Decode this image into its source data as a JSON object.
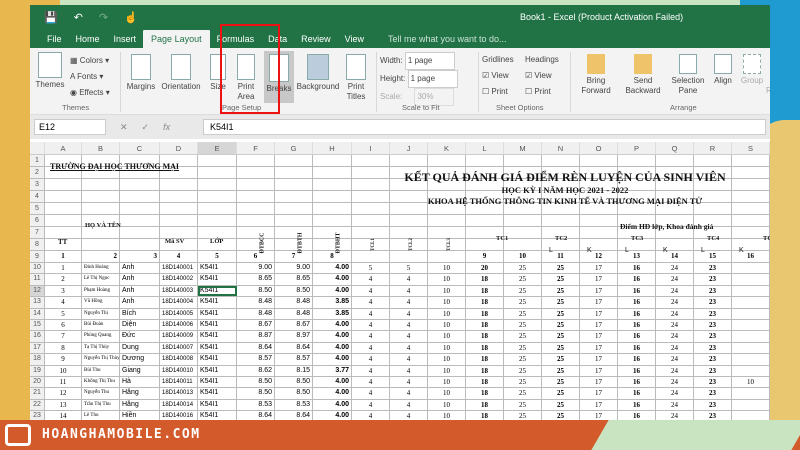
{
  "window": {
    "title": "Book1 - Excel (Product Activation Failed)"
  },
  "tabs": [
    "File",
    "Home",
    "Insert",
    "Page Layout",
    "Formulas",
    "Data",
    "Review",
    "View"
  ],
  "active_tab": "Page Layout",
  "tell_me": "Tell me what you want to do...",
  "ribbon": {
    "themes": {
      "themes": "Themes",
      "colors": "Colors",
      "fonts": "Fonts",
      "effects": "Effects",
      "group": "Themes"
    },
    "page_setup": {
      "margins": "Margins",
      "orientation": "Orientation",
      "size": "Size",
      "print_area": "Print Area",
      "breaks": "Breaks",
      "background": "Background",
      "print_titles": "Print Titles",
      "group": "Page Setup"
    },
    "scale": {
      "width_label": "Width:",
      "width": "1 page",
      "height_label": "Height:",
      "height": "1 page",
      "scale_label": "Scale:",
      "scale": "30%",
      "group": "Scale to Fit"
    },
    "sheet_options": {
      "gridlines": "Gridlines",
      "headings": "Headings",
      "view": "View",
      "print": "Print",
      "gridlines_view": true,
      "gridlines_print": false,
      "headings_view": true,
      "headings_print": false,
      "group": "Sheet Options"
    },
    "arrange": {
      "bring_forward": "Bring Forward",
      "send_backward": "Send Backward",
      "selection_pane": "Selection Pane",
      "align": "Align",
      "group_btn": "Group",
      "rotate": "Ro",
      "group": "Arrange"
    }
  },
  "formula_bar": {
    "name_box": "E12",
    "value": "K54I1"
  },
  "columns": [
    "A",
    "B",
    "C",
    "D",
    "E",
    "F",
    "G",
    "H",
    "I",
    "J",
    "K",
    "L",
    "M",
    "N",
    "O",
    "P",
    "Q",
    "R",
    "S"
  ],
  "sheet": {
    "school": "TRƯỜNG ĐẠI HỌC THƯƠNG MẠI",
    "title1": "KẾT QUẢ ĐÁNH GIÁ ĐIỂM RÈN LUYỆN CỦA SINH VIÊN",
    "title2": "HỌC KỲ I NĂM HỌC 2021 - 2022",
    "title3": "KHOA HỆ THỐNG THÔNG TIN KINH TẾ VÀ THƯƠNG MẠI ĐIỆN TỬ",
    "h_tt": "TT",
    "h_name": "HỌ VÀ TÊN",
    "h_masv": "Mã SV",
    "h_lop": "LỚP",
    "h_dtbcc": "ĐTBCC",
    "h_dtbth": "ĐTBTH",
    "h_dtbht": "ĐTBHT",
    "h_tcl1": "TCL1",
    "h_tcl2": "TCL2",
    "h_tcl3": "TCL3",
    "h_diem": "Điểm HĐ lớp, Khoa đánh giá",
    "tc": [
      "TC1",
      "TC2",
      "TC3",
      "TC4",
      "TC"
    ],
    "lk": [
      "L",
      "K",
      "L",
      "K",
      "L",
      "K",
      "L"
    ],
    "row9": [
      "1",
      "2",
      "3",
      "4",
      "5",
      "6",
      "7",
      "8",
      "",
      "",
      "",
      "9",
      "10",
      "11",
      "12",
      "13",
      "14",
      "15",
      "16"
    ],
    "rows": [
      [
        "1",
        "Đinh Hoàng",
        "Anh",
        "18D140001",
        "K54I1",
        "9.00",
        "9.00",
        "4.00",
        "5",
        "5",
        "10",
        "20",
        "25",
        "25",
        "17",
        "16",
        "24",
        "23",
        ""
      ],
      [
        "2",
        "Lê Thị Ngọc",
        "Anh",
        "18D140002",
        "K54I1",
        "8.65",
        "8.65",
        "4.00",
        "4",
        "4",
        "10",
        "18",
        "25",
        "25",
        "17",
        "16",
        "24",
        "23",
        ""
      ],
      [
        "3",
        "Phạm Hoàng",
        "Anh",
        "18D140003",
        "K54I1",
        "8.50",
        "8.50",
        "4.00",
        "4",
        "4",
        "10",
        "18",
        "25",
        "25",
        "17",
        "16",
        "24",
        "23",
        ""
      ],
      [
        "4",
        "Vũ Hồng",
        "Anh",
        "18D140004",
        "K54I1",
        "8.48",
        "8.48",
        "3.85",
        "4",
        "4",
        "10",
        "18",
        "25",
        "25",
        "17",
        "16",
        "24",
        "23",
        ""
      ],
      [
        "5",
        "Nguyễn Thị",
        "Bích",
        "18D140005",
        "K54I1",
        "8.48",
        "8.48",
        "3.85",
        "4",
        "4",
        "10",
        "18",
        "25",
        "25",
        "17",
        "16",
        "24",
        "23",
        ""
      ],
      [
        "6",
        "Bùi Đoàn",
        "Diện",
        "18D140006",
        "K54I1",
        "8.67",
        "8.67",
        "4.00",
        "4",
        "4",
        "10",
        "18",
        "25",
        "25",
        "17",
        "16",
        "24",
        "23",
        ""
      ],
      [
        "7",
        "Phùng Quang",
        "Đức",
        "18D140009",
        "K54I1",
        "8.87",
        "8.97",
        "4.00",
        "4",
        "4",
        "10",
        "18",
        "25",
        "25",
        "17",
        "16",
        "24",
        "23",
        ""
      ],
      [
        "8",
        "Tạ Thị Thùy",
        "Dung",
        "18D140007",
        "K54I1",
        "8.64",
        "8.64",
        "4.00",
        "4",
        "4",
        "10",
        "18",
        "25",
        "25",
        "17",
        "16",
        "24",
        "23",
        ""
      ],
      [
        "9",
        "Nguyễn Thị Thùy",
        "Dương",
        "18D140008",
        "K54I1",
        "8.57",
        "8.57",
        "4.00",
        "4",
        "4",
        "10",
        "18",
        "25",
        "25",
        "17",
        "16",
        "24",
        "23",
        ""
      ],
      [
        "10",
        "Bùi Thu",
        "Giang",
        "18D140010",
        "K54I1",
        "8.62",
        "8.15",
        "3.77",
        "4",
        "4",
        "10",
        "18",
        "25",
        "25",
        "17",
        "16",
        "24",
        "23",
        ""
      ],
      [
        "11",
        "Khổng Thị Thu",
        "Hà",
        "18D140011",
        "K54I1",
        "8.50",
        "8.50",
        "4.00",
        "4",
        "4",
        "10",
        "18",
        "25",
        "25",
        "17",
        "16",
        "24",
        "23",
        "10"
      ],
      [
        "12",
        "Nguyễn Thu",
        "Hằng",
        "18D140013",
        "K54I1",
        "8.50",
        "8.50",
        "4.00",
        "4",
        "4",
        "10",
        "18",
        "25",
        "25",
        "17",
        "16",
        "24",
        "23",
        ""
      ],
      [
        "13",
        "Trần Thị Thu",
        "Hằng",
        "18D140014",
        "K54I1",
        "8.53",
        "8.53",
        "4.00",
        "4",
        "4",
        "10",
        "18",
        "25",
        "25",
        "17",
        "16",
        "24",
        "23",
        ""
      ],
      [
        "14",
        "Lê Thu",
        "Hiền",
        "18D140016",
        "K54I1",
        "8.64",
        "8.64",
        "4.00",
        "4",
        "4",
        "10",
        "18",
        "25",
        "25",
        "17",
        "16",
        "24",
        "23",
        ""
      ]
    ]
  },
  "watermark": "HOANGHAMOBILE.COM",
  "colors": {
    "excel_green": "#217346",
    "highlight": "#e11111",
    "brand_orange": "#d35a2a"
  }
}
